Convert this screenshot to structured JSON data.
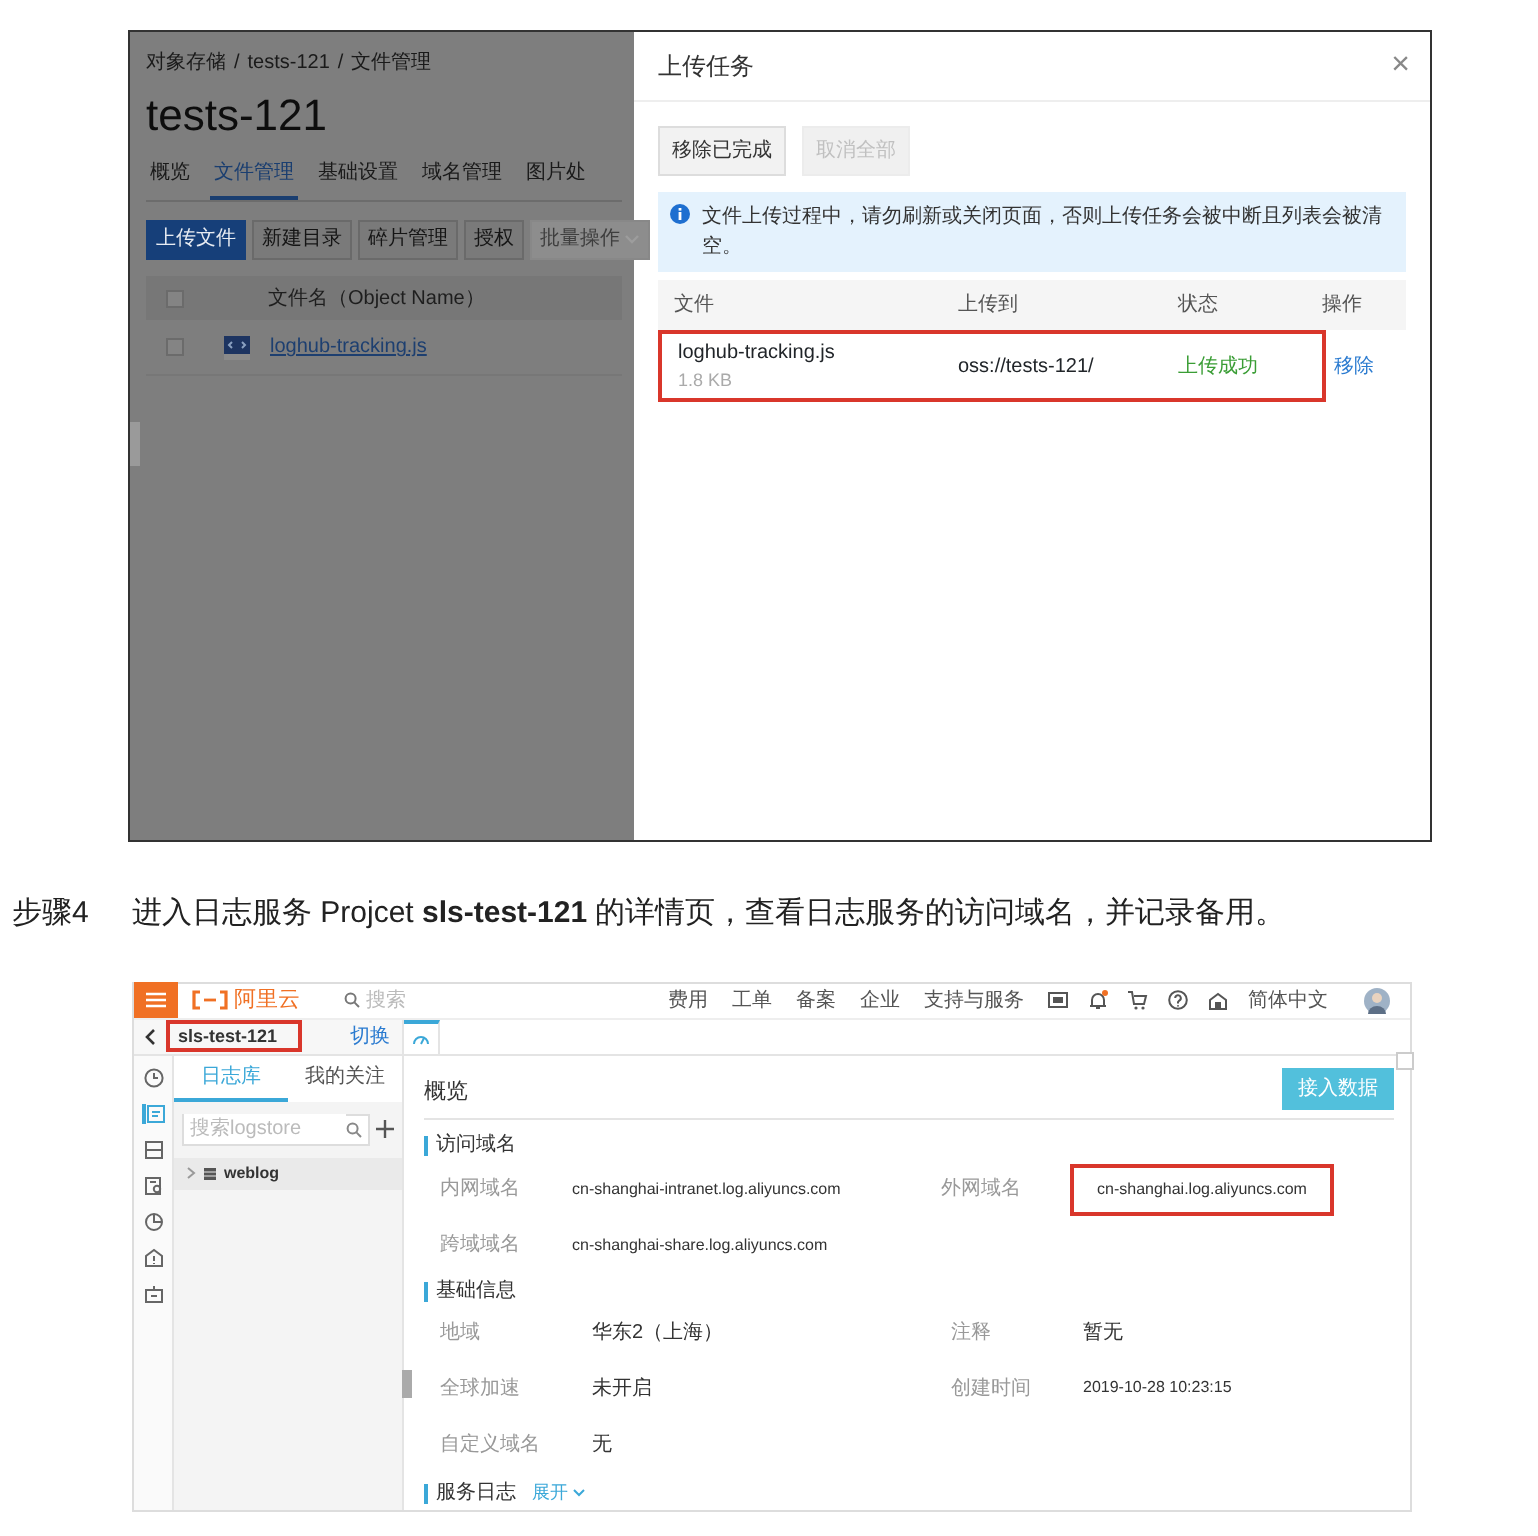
{
  "screenshot_1": {
    "breadcrumb": [
      {
        "label": "对象存储",
        "separator": "/"
      },
      {
        "label": "tests-121",
        "separator": "/"
      },
      {
        "label": "文件管理"
      }
    ],
    "title": "tests-121",
    "tabs": [
      {
        "label": "概览",
        "selected": false
      },
      {
        "label": "文件管理",
        "selected": true
      },
      {
        "label": "基础设置",
        "selected": false
      },
      {
        "label": "域名管理",
        "selected": false
      },
      {
        "label": "图片处",
        "selected": false
      }
    ],
    "buttons": [
      {
        "label": "上传文件",
        "kind": "primary",
        "disabled": false
      },
      {
        "label": "新建目录",
        "kind": "default",
        "disabled": false
      },
      {
        "label": "碎片管理",
        "kind": "default",
        "disabled": false
      },
      {
        "label": "授权",
        "kind": "default",
        "disabled": false
      },
      {
        "label": "批量操作",
        "kind": "dropdown",
        "disabled": true
      }
    ],
    "table": {
      "header_checked": false,
      "columns": [
        "文件名（Object Name）"
      ],
      "rows": [
        {
          "name": "loghub-tracking.js",
          "checked": false
        }
      ]
    },
    "dialog": {
      "title": "上传任务",
      "close": "×",
      "buttons": [
        {
          "label": "移除已完成",
          "disabled": false
        },
        {
          "label": "取消全部",
          "disabled": true
        }
      ],
      "notice": "文件上传过程中，请勿刷新或关闭页面，否则上传任务会被中断且列表会被清空。",
      "columns": [
        "文件",
        "上传到",
        "状态",
        "操作"
      ],
      "rows": [
        {
          "file": "loghub-tracking.js",
          "size": "1.8 KB",
          "destination": "oss://tests-121/",
          "status": "上传成功",
          "action": "移除",
          "highlighted": true
        }
      ]
    }
  },
  "caption": {
    "step": "步骤4",
    "text": "进入日志服务 Projcet **sls-test-121** 的详情页，查看日志服务的访问域名，并记录备用。"
  },
  "screenshot_2": {
    "top_bar": {
      "brand": "阿里云",
      "search_placeholder": "搜索",
      "links": [
        "费用",
        "工单",
        "备案",
        "企业",
        "支持与服务"
      ],
      "has_notification": true,
      "language": "简体中文"
    },
    "project_bar": {
      "name": "sls-test-121",
      "highlighted": true,
      "switch_label": "切换"
    },
    "rail": [
      {
        "selected": false
      },
      {
        "selected": true
      },
      {
        "selected": false
      },
      {
        "selected": false
      },
      {
        "selected": false
      },
      {
        "selected": false
      },
      {
        "selected": false
      }
    ],
    "sidebar": {
      "tabs": [
        {
          "label": "日志库",
          "selected": true
        },
        {
          "label": "我的关注",
          "selected": false
        }
      ],
      "search_placeholder": "搜索logstore",
      "logstores": [
        {
          "name": "weblog",
          "expanded": false
        }
      ]
    },
    "main": {
      "title": "概览",
      "action": "接入数据",
      "corner_checkbox": {
        "checked": false
      },
      "sections": [
        {
          "title": "访问域名",
          "fields": [
            {
              "label": "内网域名",
              "value": "cn-shanghai-intranet.log.aliyuncs.com",
              "highlighted": false
            },
            {
              "label": "外网域名",
              "value": "cn-shanghai.log.aliyuncs.com",
              "highlighted": true
            },
            {
              "label": "跨域域名",
              "value": "cn-shanghai-share.log.aliyuncs.com",
              "highlighted": false
            }
          ]
        },
        {
          "title": "基础信息",
          "fields": [
            {
              "label": "地域",
              "value": "华东2（上海）",
              "highlighted": false
            },
            {
              "label": "注释",
              "value": "暂无",
              "highlighted": false
            },
            {
              "label": "全球加速",
              "value": "未开启",
              "highlighted": false
            },
            {
              "label": "创建时间",
              "value": "2019-10-28 10:23:15",
              "highlighted": false
            },
            {
              "label": "自定义域名",
              "value": "无",
              "highlighted": false
            }
          ]
        },
        {
          "title": "服务日志",
          "toggle": "展开"
        }
      ]
    }
  }
}
